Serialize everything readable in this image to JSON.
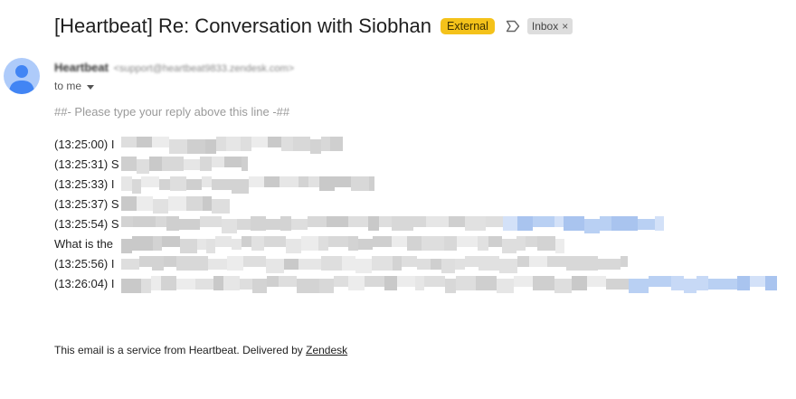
{
  "subject": {
    "title": "[Heartbeat] Re: Conversation with Siobhan",
    "external_badge": "External",
    "inbox_label": "Inbox",
    "inbox_remove": "×"
  },
  "sender": {
    "name": "Heartbeat",
    "email": "<support@heartbeat9833.zendesk.com>",
    "to_label": "to me"
  },
  "body": {
    "reply_marker": "##- Please type your reply above this line -##",
    "log_lines": [
      "(13:25:00) I",
      "(13:25:31) S",
      "(13:25:33) I",
      "(13:25:37) S",
      "(13:25:54) S",
      "What is the",
      "(13:25:56) I",
      "(13:26:04) I"
    ]
  },
  "footer": {
    "text": "This email is a service from Heartbeat. Delivered by ",
    "link_text": "Zendesk"
  },
  "colors": {
    "external_badge": "#f4c21a",
    "inbox_badge": "#dddddd",
    "avatar": "#aecbfa",
    "avatar_figure": "#4285f4",
    "redaction_gray": "#d9d9d9",
    "redaction_blue": "#a9c4ef"
  },
  "icons": {
    "label": "label-outline-icon",
    "avatar": "person-icon",
    "caret": "caret-down-icon"
  }
}
